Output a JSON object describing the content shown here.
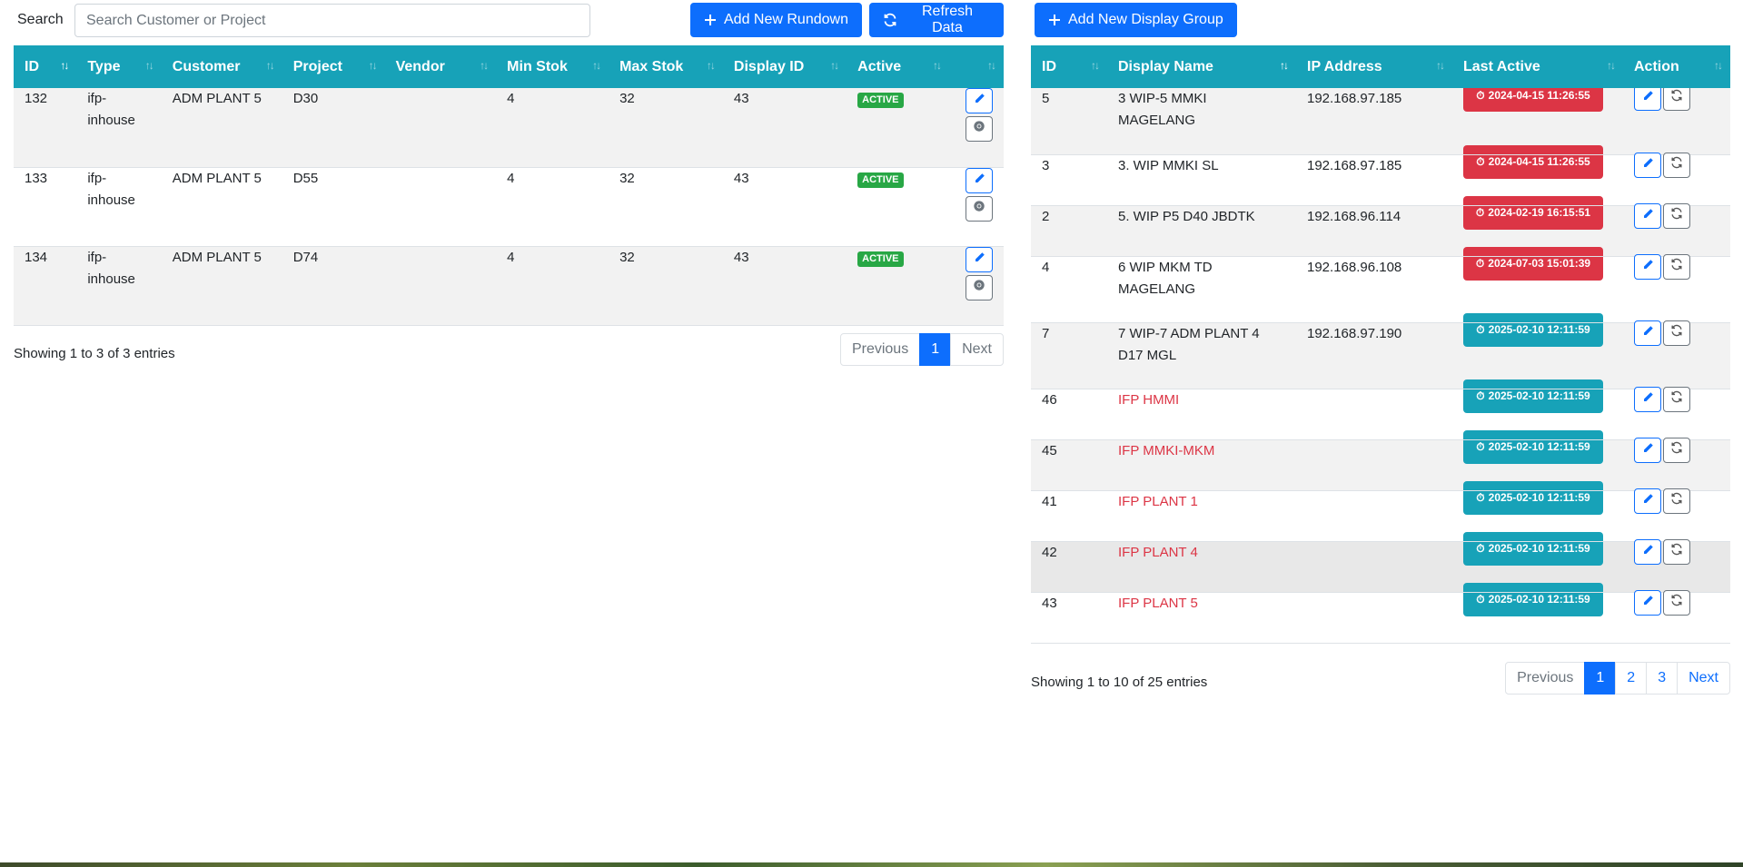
{
  "search": {
    "label": "Search",
    "placeholder": "Search Customer or Project"
  },
  "buttons": {
    "add_rundown": "Add New Rundown",
    "refresh": "Refresh Data",
    "add_display_group": "Add New Display Group"
  },
  "left_table": {
    "headers": [
      "ID",
      "Type",
      "Customer",
      "Project",
      "Vendor",
      "Min Stok",
      "Max Stok",
      "Display ID",
      "Active",
      ""
    ],
    "rows": [
      {
        "id": "132",
        "type": "ifp-inhouse",
        "customer": "ADM PLANT 5",
        "project": "D30",
        "vendor": "",
        "min": "4",
        "max": "32",
        "display_id": "43",
        "active": "ACTIVE"
      },
      {
        "id": "133",
        "type": "ifp-inhouse",
        "customer": "ADM PLANT 5",
        "project": "D55",
        "vendor": "",
        "min": "4",
        "max": "32",
        "display_id": "43",
        "active": "ACTIVE"
      },
      {
        "id": "134",
        "type": "ifp-inhouse",
        "customer": "ADM PLANT 5",
        "project": "D74",
        "vendor": "",
        "min": "4",
        "max": "32",
        "display_id": "43",
        "active": "ACTIVE"
      }
    ],
    "info": "Showing 1 to 3 of 3 entries",
    "pager": {
      "previous": "Previous",
      "pages": [
        "1"
      ],
      "next": "Next"
    }
  },
  "right_table": {
    "headers": [
      "ID",
      "Display Name",
      "IP Address",
      "Last Active",
      "Action"
    ],
    "rows": [
      {
        "id": "5",
        "name": "3 WIP-5 MMKI MAGELANG",
        "ip": "192.168.97.185",
        "last_active": "2024-04-15 11:26:55",
        "status": "red"
      },
      {
        "id": "3",
        "name": "3. WIP MMKI SL",
        "ip": "192.168.97.185",
        "last_active": "2024-04-15 11:26:55",
        "status": "red"
      },
      {
        "id": "2",
        "name": "5. WIP P5 D40 JBDTK",
        "ip": "192.168.96.114",
        "last_active": "2024-02-19 16:15:51",
        "status": "red"
      },
      {
        "id": "4",
        "name": "6 WIP MKM TD MAGELANG",
        "ip": "192.168.96.108",
        "last_active": "2024-07-03 15:01:39",
        "status": "red"
      },
      {
        "id": "7",
        "name": "7 WIP-7 ADM PLANT 4 D17 MGL",
        "ip": "192.168.97.190",
        "last_active": "2025-02-10 12:11:59",
        "status": "teal"
      },
      {
        "id": "46",
        "name": "IFP HMMI",
        "ip": "",
        "last_active": "2025-02-10 12:11:59",
        "status": "teal"
      },
      {
        "id": "45",
        "name": "IFP MMKI-MKM",
        "ip": "",
        "last_active": "2025-02-10 12:11:59",
        "status": "teal"
      },
      {
        "id": "41",
        "name": "IFP PLANT 1",
        "ip": "",
        "last_active": "2025-02-10 12:11:59",
        "status": "teal"
      },
      {
        "id": "42",
        "name": "IFP PLANT 4",
        "ip": "",
        "last_active": "2025-02-10 12:11:59",
        "status": "teal"
      },
      {
        "id": "43",
        "name": "IFP PLANT 5",
        "ip": "",
        "last_active": "2025-02-10 12:11:59",
        "status": "teal"
      }
    ],
    "info": "Showing 1 to 10 of 25 entries",
    "pager": {
      "previous": "Previous",
      "pages": [
        "1",
        "2",
        "3"
      ],
      "next": "Next"
    }
  },
  "icons": {
    "plus": "plus-icon",
    "refresh": "refresh-icon",
    "edit": "pencil-icon",
    "chrome": "chrome-icon",
    "sync": "sync-icon",
    "clock": "alarm-icon",
    "sort": "sort-icon"
  },
  "colors": {
    "header": "#17a2b8",
    "primary": "#0d6efd",
    "danger": "#dc3545",
    "success": "#28a745"
  }
}
